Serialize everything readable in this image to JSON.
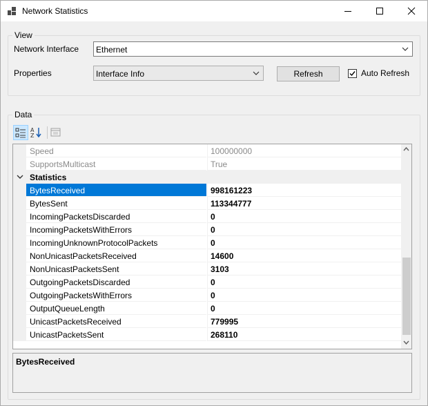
{
  "window": {
    "title": "Network Statistics"
  },
  "view": {
    "legend": "View",
    "interface_label": "Network Interface",
    "interface_value": "Ethernet",
    "properties_label": "Properties",
    "properties_value": "Interface Info",
    "refresh_label": "Refresh",
    "auto_refresh_label": "Auto Refresh",
    "auto_refresh_checked": true
  },
  "data": {
    "legend": "Data",
    "rows_top": [
      {
        "name": "Speed",
        "value": "100000000"
      },
      {
        "name": "SupportsMulticast",
        "value": "True"
      }
    ],
    "category": "Statistics",
    "rows": [
      {
        "name": "BytesReceived",
        "value": "998161223"
      },
      {
        "name": "BytesSent",
        "value": "113344777"
      },
      {
        "name": "IncomingPacketsDiscarded",
        "value": "0"
      },
      {
        "name": "IncomingPacketsWithErrors",
        "value": "0"
      },
      {
        "name": "IncomingUnknownProtocolPackets",
        "value": "0"
      },
      {
        "name": "NonUnicastPacketsReceived",
        "value": "14600"
      },
      {
        "name": "NonUnicastPacketsSent",
        "value": "3103"
      },
      {
        "name": "OutgoingPacketsDiscarded",
        "value": "0"
      },
      {
        "name": "OutgoingPacketsWithErrors",
        "value": "0"
      },
      {
        "name": "OutputQueueLength",
        "value": "0"
      },
      {
        "name": "UnicastPacketsReceived",
        "value": "779995"
      },
      {
        "name": "UnicastPacketsSent",
        "value": "268110"
      }
    ],
    "description_title": "BytesReceived"
  },
  "colors": {
    "selection": "#0078d7",
    "window_bg": "#f0f0f0"
  }
}
